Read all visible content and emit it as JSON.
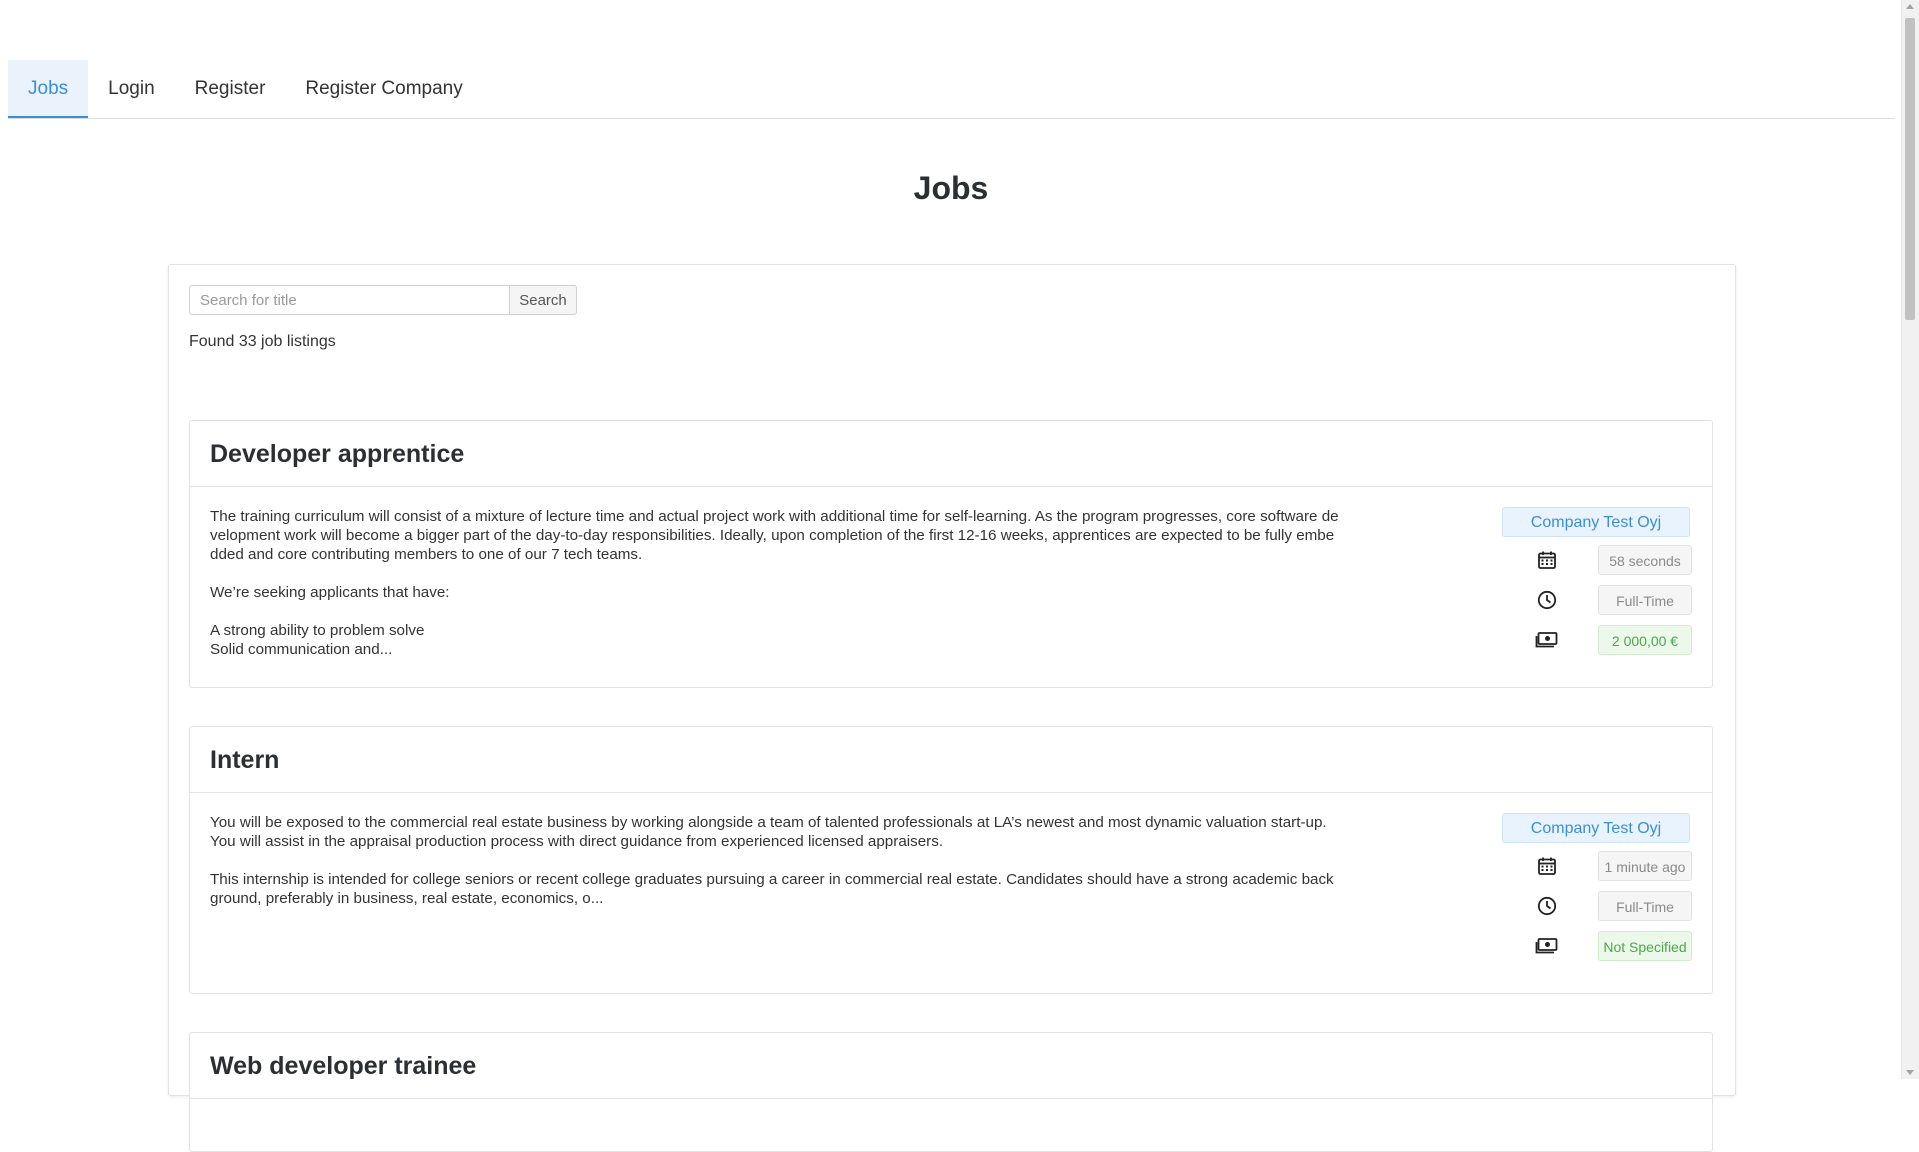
{
  "nav": {
    "tabs": [
      {
        "label": "Jobs",
        "active": true
      },
      {
        "label": "Login",
        "active": false
      },
      {
        "label": "Register",
        "active": false
      },
      {
        "label": "Register Company",
        "active": false
      }
    ]
  },
  "page": {
    "title": "Jobs"
  },
  "search": {
    "placeholder": "Search for title",
    "value": "",
    "button_label": "Search",
    "found_text": "Found 33 job listings"
  },
  "jobs": [
    {
      "title": "Developer apprentice",
      "description": "The training curriculum will consist of a mixture of lecture time and actual project work with additional time for self-learning. As the program progresses, core software development work will become a bigger part of the day-to-day responsibilities. Ideally, upon completion of the first 12-16 weeks, apprentices are expected to be fully embedded and core contributing members to one of our 7 tech teams.\n\nWe’re seeking applicants that have:\n\nA strong ability to problem solve\nSolid communication and...",
      "company": "Company Test Oyj",
      "posted": "58 seconds ago",
      "type": "Full-Time",
      "salary": "2 000,00 €"
    },
    {
      "title": "Intern",
      "description": "You will be exposed to the commercial real estate business by working alongside a team of talented professionals at LA’s newest and most dynamic valuation start-up. You will assist in the appraisal production process with direct guidance from experienced licensed appraisers.\n\nThis internship is intended for college seniors or recent college graduates pursuing a career in commercial real estate. Candidates should have a strong academic background, preferably in business, real estate, economics, o...",
      "company": "Company Test Oyj",
      "posted": "1 minute ago",
      "type": "Full-Time",
      "salary": "Not Specified"
    },
    {
      "title": "Web developer trainee"
    }
  ],
  "icons": {
    "calendar": "calendar-icon",
    "clock": "clock-icon",
    "money": "money-icon"
  },
  "colors": {
    "accent": "#3b8fd6",
    "salary_green": "#4aa84a"
  }
}
